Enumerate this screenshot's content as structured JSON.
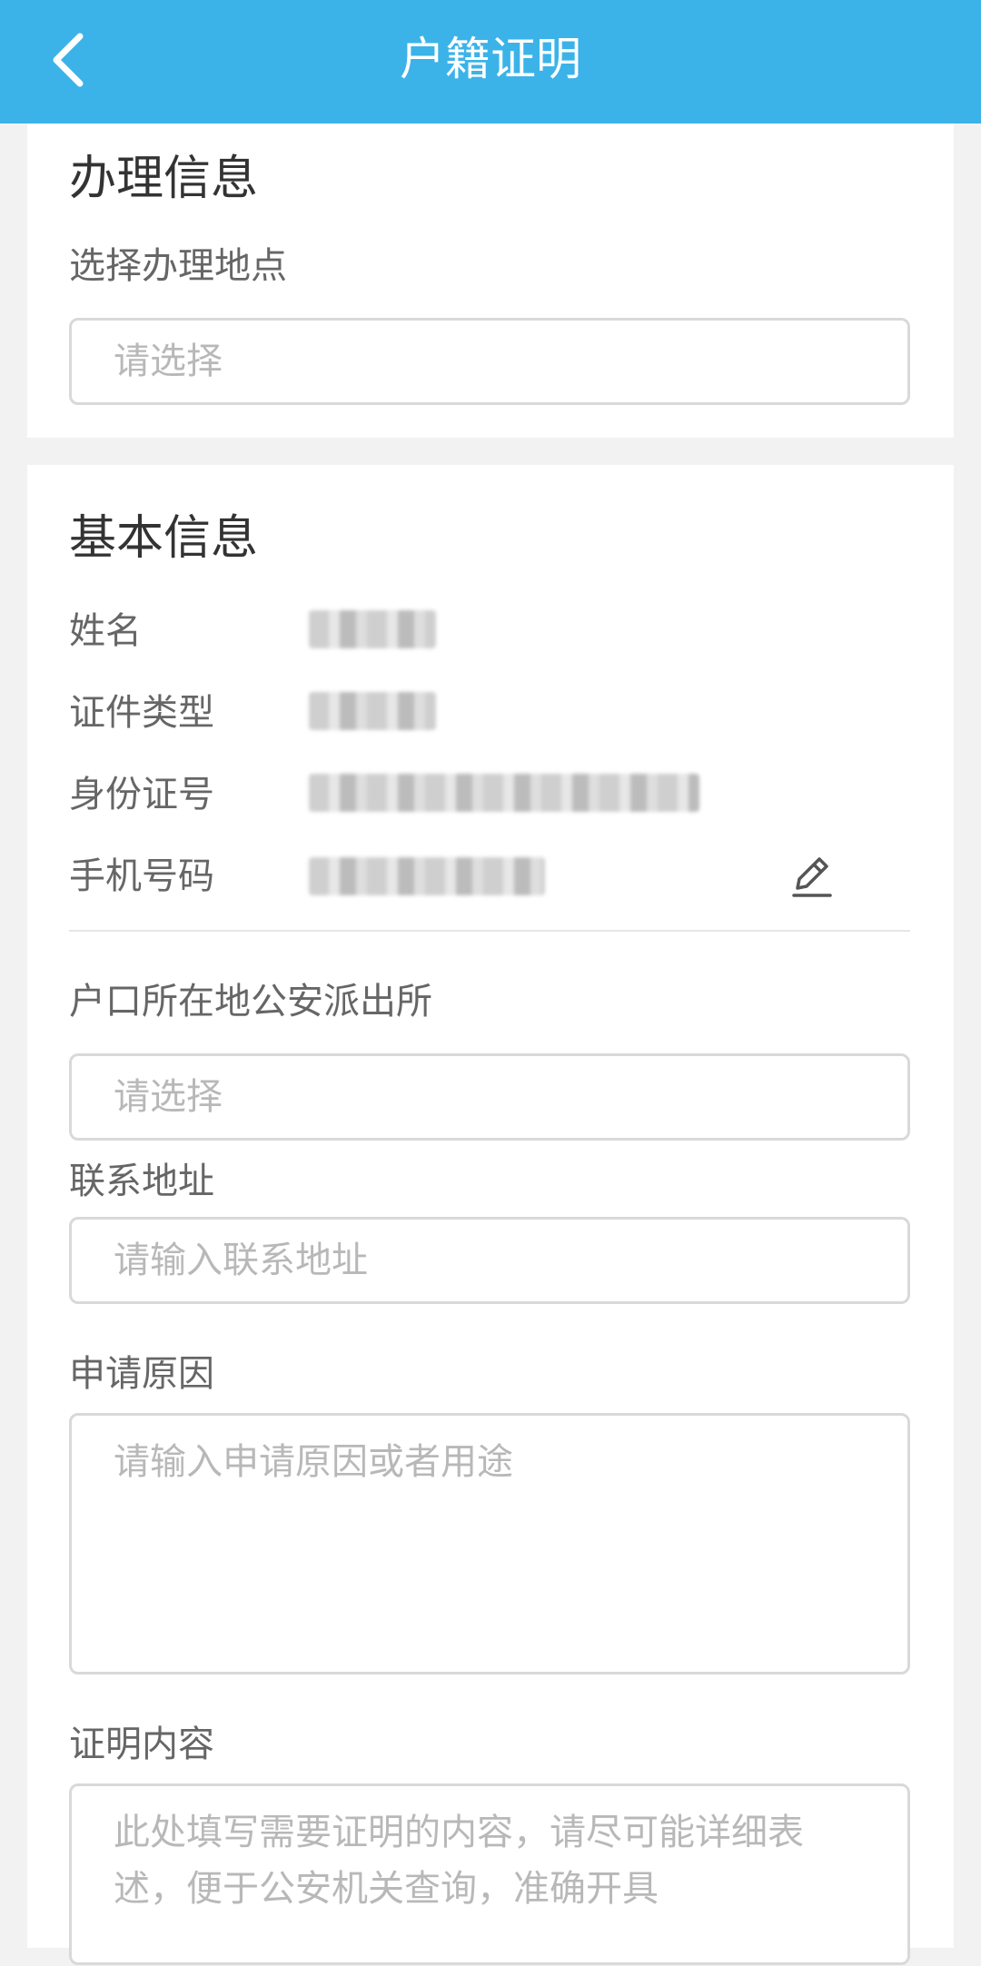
{
  "header": {
    "title": "户籍证明",
    "back_icon": "chevron-left-icon"
  },
  "handling": {
    "section_title": "办理信息",
    "location_label": "选择办理地点",
    "location_placeholder": "请选择"
  },
  "basic": {
    "section_title": "基本信息",
    "rows": [
      {
        "label": "姓名"
      },
      {
        "label": "证件类型"
      },
      {
        "label": "身份证号"
      },
      {
        "label": "手机号码"
      }
    ],
    "edit_icon": "pencil-icon",
    "police_label": "户口所在地公安派出所",
    "police_placeholder": "请选择",
    "address_label": "联系地址",
    "address_placeholder": "请输入联系地址",
    "reason_label": "申请原因",
    "reason_placeholder": "请输入申请原因或者用途",
    "content_label": "证明内容",
    "content_placeholder": "此处填写需要证明的内容，请尽可能详细表述，便于公安机关查询，准确开具"
  },
  "colors": {
    "header": "#3bb3e9",
    "background": "#f2f2f2"
  }
}
